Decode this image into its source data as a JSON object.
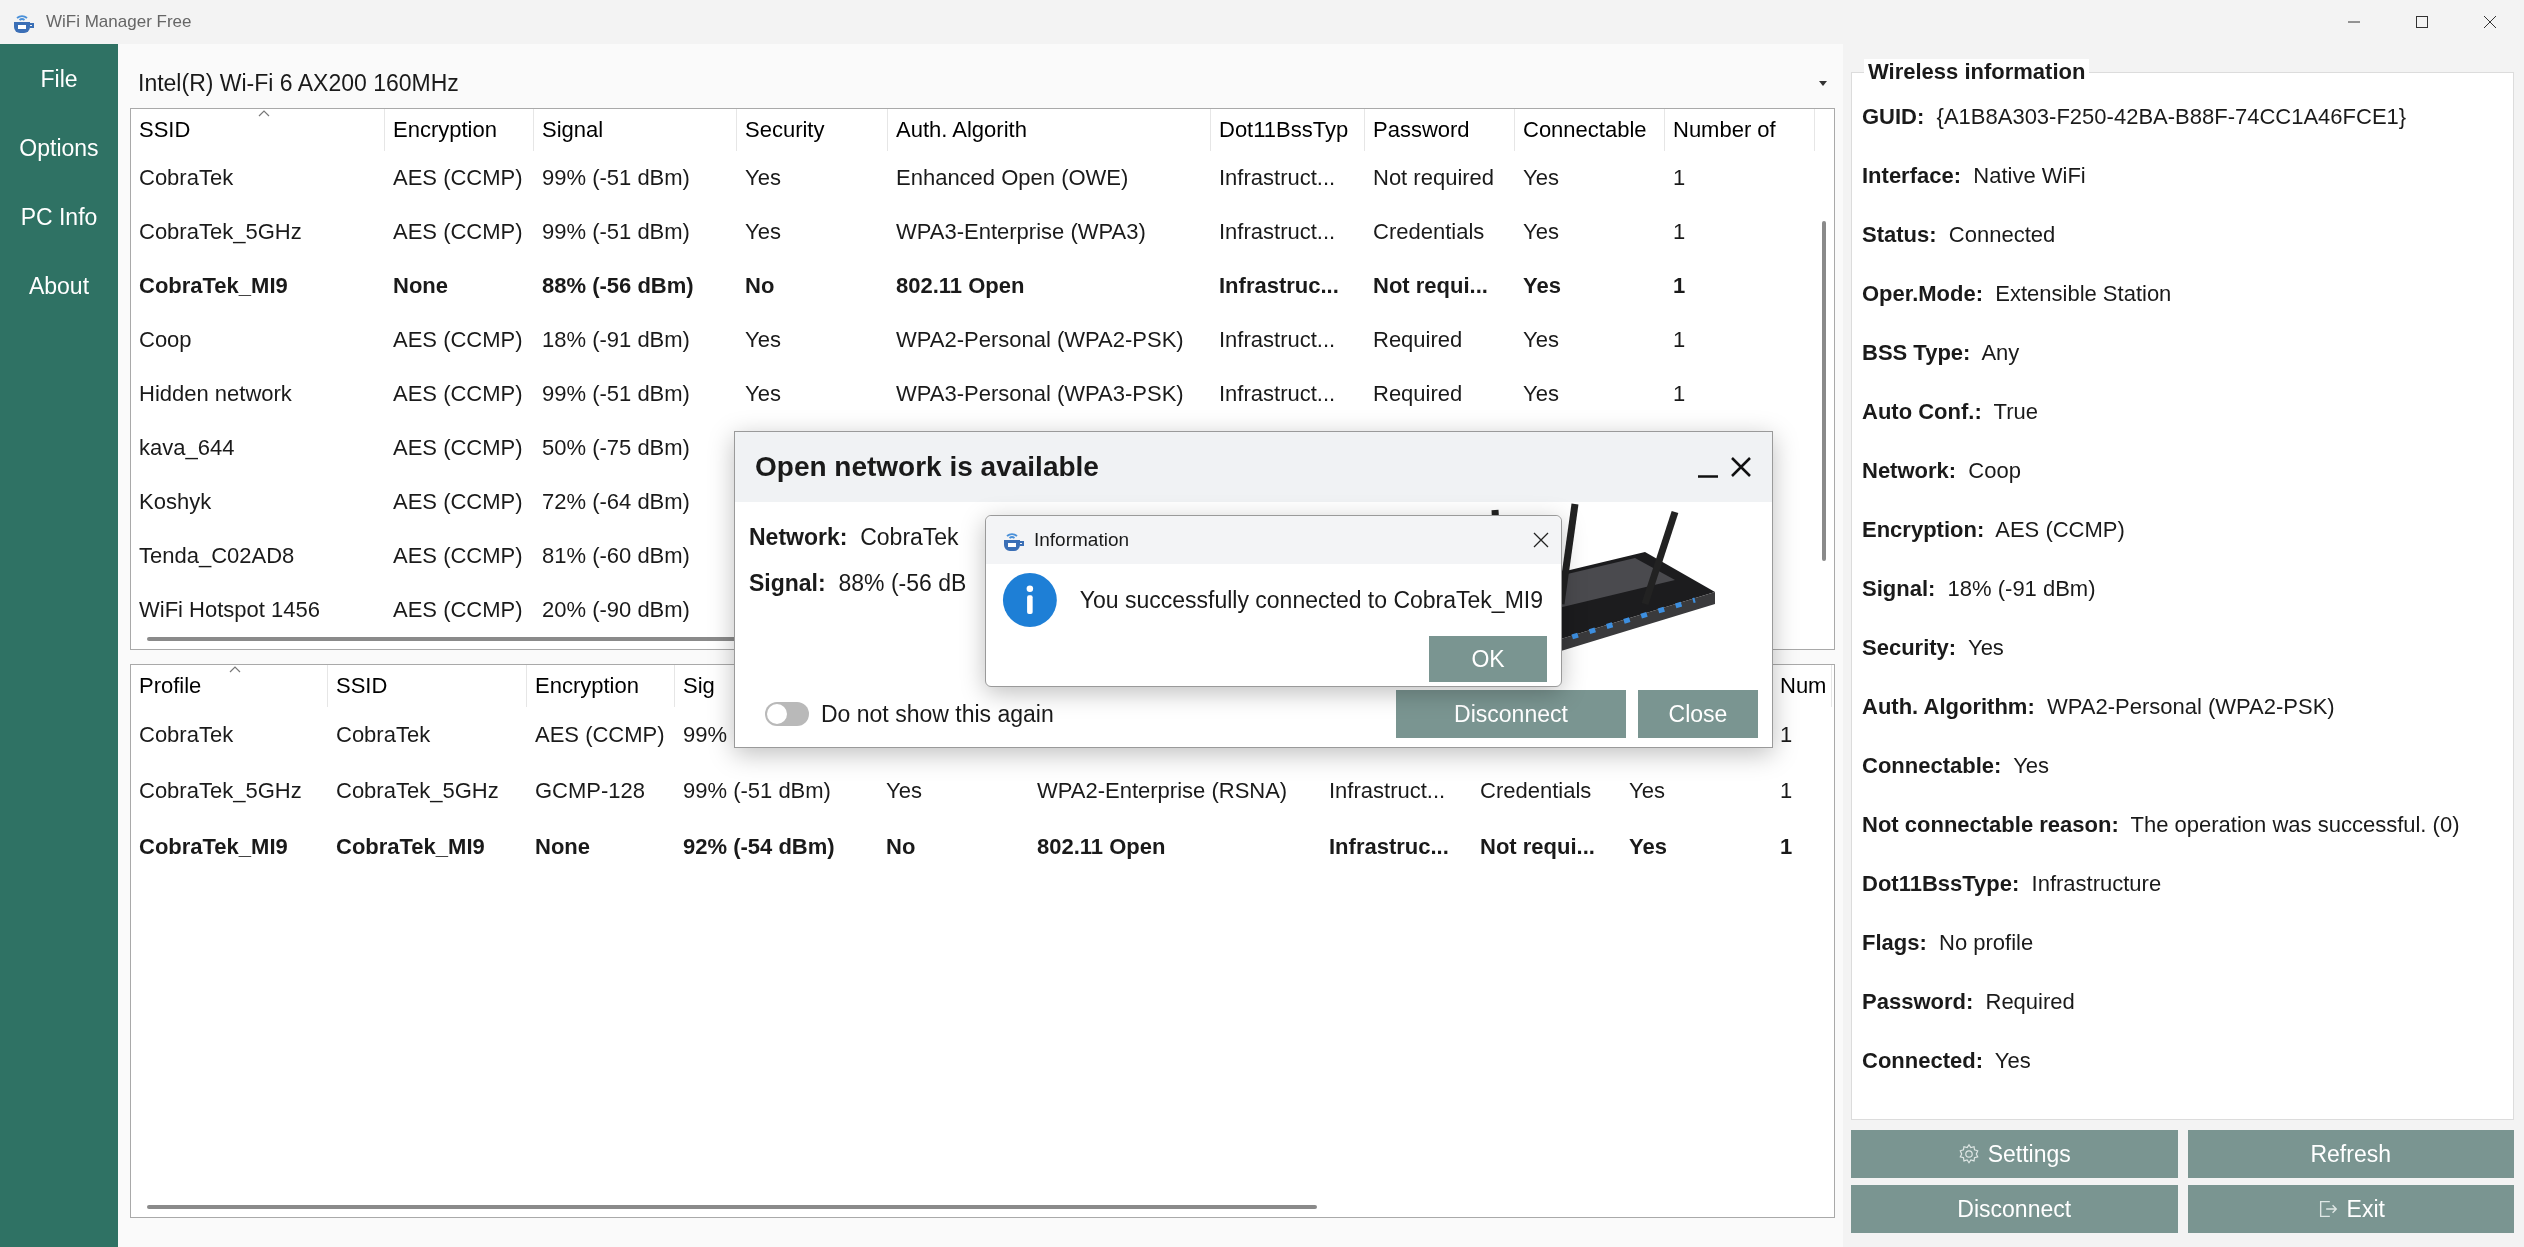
{
  "window": {
    "title": "WiFi Manager Free"
  },
  "sidebar_items": [
    "File",
    "Options",
    "PC Info",
    "About"
  ],
  "adapter_select": {
    "value": "Intel(R) Wi-Fi 6 AX200 160MHz"
  },
  "networks_table": {
    "columns": [
      "SSID",
      "Encryption",
      "Signal",
      "Security",
      "Auth. Algorith",
      "Dot11BssTyp",
      "Password",
      "Connectable",
      "Number of"
    ],
    "rows": [
      {
        "connected": false,
        "cells": [
          "CobraTek",
          "AES (CCMP)",
          "99% (-51 dBm)",
          "Yes",
          "Enhanced Open (OWE)",
          "Infrastruct...",
          "Not required",
          "Yes",
          "1"
        ]
      },
      {
        "connected": false,
        "cells": [
          "CobraTek_5GHz",
          "AES (CCMP)",
          "99% (-51 dBm)",
          "Yes",
          "WPA3-Enterprise (WPA3)",
          "Infrastruct...",
          "Credentials",
          "Yes",
          "1"
        ]
      },
      {
        "connected": true,
        "cells": [
          "CobraTek_MI9",
          "None",
          "88% (-56 dBm)",
          "No",
          "802.11 Open",
          "Infrastruc...",
          "Not requi...",
          "Yes",
          "1"
        ]
      },
      {
        "connected": false,
        "cells": [
          "Coop",
          "AES (CCMP)",
          "18% (-91 dBm)",
          "Yes",
          "WPA2-Personal (WPA2-PSK)",
          "Infrastruct...",
          "Required",
          "Yes",
          "1"
        ]
      },
      {
        "connected": false,
        "cells": [
          "Hidden network",
          "AES (CCMP)",
          "99% (-51 dBm)",
          "Yes",
          "WPA3-Personal (WPA3-PSK)",
          "Infrastruct...",
          "Required",
          "Yes",
          "1"
        ]
      },
      {
        "connected": false,
        "cells": [
          "kava_644",
          "AES (CCMP)",
          "50% (-75 dBm)"
        ]
      },
      {
        "connected": false,
        "cells": [
          "Koshyk",
          "AES (CCMP)",
          "72% (-64 dBm)"
        ]
      },
      {
        "connected": false,
        "cells": [
          "Tenda_C02AD8",
          "AES (CCMP)",
          "81% (-60 dBm)"
        ]
      },
      {
        "connected": false,
        "cells": [
          "WiFi Hotspot 1456",
          "AES (CCMP)",
          "20% (-90 dBm)"
        ]
      }
    ]
  },
  "profiles_table": {
    "columns": [
      "Profile",
      "SSID",
      "Encryption",
      "Sig"
    ],
    "columns_tail": [
      "Num"
    ],
    "rows": [
      {
        "connected": false,
        "cells": [
          "CobraTek",
          "CobraTek",
          "AES (CCMP)",
          "99%"
        ],
        "tail": [
          "1"
        ]
      },
      {
        "connected": false,
        "cells": [
          "CobraTek_5GHz",
          "CobraTek_5GHz",
          "GCMP-128",
          "99% (-51 dBm)",
          "Yes",
          "WPA2-Enterprise (RSNA)",
          "Infrastruct...",
          "Credentials",
          "Yes",
          "1"
        ]
      },
      {
        "connected": true,
        "cells": [
          "CobraTek_MI9",
          "CobraTek_MI9",
          "None",
          "92% (-54 dBm)",
          "No",
          "802.11 Open",
          "Infrastruc...",
          "Not requi...",
          "Yes",
          "1"
        ]
      }
    ]
  },
  "wireless_information": {
    "title": "Wireless information",
    "items": [
      {
        "label": "GUID:",
        "value": "{A1B8A303-F250-42BA-B88F-74CC1A46FCE1}"
      },
      {
        "label": "Interface:",
        "value": "Native WiFi"
      },
      {
        "label": "Status:",
        "value": "Connected"
      },
      {
        "label": "Oper.Mode:",
        "value": "Extensible Station"
      },
      {
        "label": "BSS Type:",
        "value": "Any"
      },
      {
        "label": "Auto Conf.:",
        "value": "True"
      },
      {
        "label": "Network:",
        "value": "Coop"
      },
      {
        "label": "Encryption:",
        "value": "AES (CCMP)"
      },
      {
        "label": "Signal:",
        "value": "18% (-91 dBm)"
      },
      {
        "label": "Security:",
        "value": "Yes"
      },
      {
        "label": "Auth. Algorithm:",
        "value": "WPA2-Personal (WPA2-PSK)"
      },
      {
        "label": "Connectable:",
        "value": "Yes"
      },
      {
        "label": "Not connectable reason:",
        "value": "The operation was successful. (0)"
      },
      {
        "label": "Dot11BssType:",
        "value": "Infrastructure"
      },
      {
        "label": "Flags:",
        "value": "No profile"
      },
      {
        "label": "Password:",
        "value": "Required"
      },
      {
        "label": "Connected:",
        "value": "Yes"
      }
    ]
  },
  "buttons": [
    {
      "label": "Settings",
      "kind": "settings"
    },
    {
      "label": "Refresh",
      "kind": "plain"
    },
    {
      "label": "Disconnect",
      "kind": "plain"
    },
    {
      "label": "Exit",
      "kind": "exit"
    }
  ],
  "open_network_dialog": {
    "title": "Open network is available",
    "fields": [
      {
        "label": "Network:",
        "value": "CobraTek"
      },
      {
        "label": "Signal:",
        "value": "88% (-56 dB"
      }
    ],
    "toggle": {
      "label": "Do not show this again",
      "on": false
    },
    "buttons": [
      "Disconnect",
      "Close"
    ]
  },
  "info_dialog": {
    "title": "Information",
    "message": "You successfully connected to CobraTek_MI9",
    "buttons": [
      "OK"
    ]
  }
}
